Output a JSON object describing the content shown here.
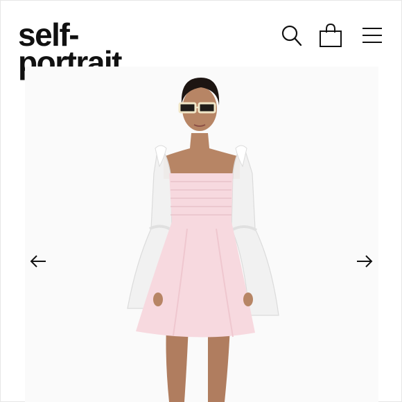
{
  "brand": {
    "line1": "self-",
    "line2": "portrait"
  },
  "header": {
    "icons": [
      "search-icon",
      "shopping-bag-icon",
      "menu-icon"
    ]
  },
  "carousel": {
    "prev_icon": "arrow-left-icon",
    "next_icon": "arrow-right-icon"
  },
  "product": {
    "image": "model-wearing-pink-mini-dress",
    "colors": {
      "dress": "#f7d9df",
      "dress_shade": "#efc7cf",
      "tulle": "#f1f1f1",
      "skin": "#b78565",
      "hair": "#1d1512"
    }
  }
}
